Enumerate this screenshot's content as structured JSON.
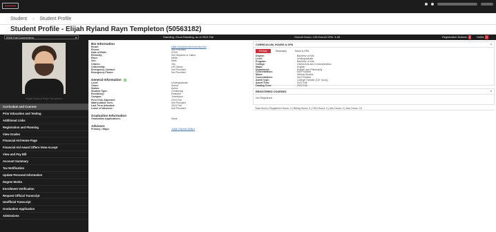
{
  "topbar": {
    "logo_icon": "university-logo-icon",
    "icons": [
      "grid-icon",
      "user-icon"
    ]
  },
  "breadcrumb": {
    "home": "Student",
    "sep": "›",
    "current": "Student Profile"
  },
  "page": {
    "title": "Student Profile - Elijah Ryland Rayn Templeton (50563182)"
  },
  "termbar": {
    "term_select": "2026 Fall Current term",
    "standing": "Standing: Good Standing, as of 2024 Fall",
    "overall_hours": "Overall Hours: 126",
    "overall_gpa": "Overall GPA: 3.48",
    "registration_notices": "Registration Notices:",
    "registration_count": "0",
    "holds": "Holds:",
    "holds_count": "0"
  },
  "sidebar": {
    "photo_caption": "Elijah Ryland Rayn Templeton",
    "items": [
      "Curriculum and Courses",
      "Prior Education and Testing",
      "Additional Links",
      "Registration and Planning",
      "View Grades",
      "Financial Aid Home Page",
      "Financial Aid Award Offers-View-Accept",
      "View and Pay Bill",
      "Account Summary",
      "Tax Notification",
      "Update Personal Information",
      "Degree Works",
      "Enrollment Verification",
      "Request Official Transcript",
      "Unofficial Transcript",
      "Graduation Application",
      "Admissions"
    ]
  },
  "bio": {
    "title": "Bio Information",
    "rows": [
      {
        "k": "Email:",
        "v": "elijah.templeton@university.edu",
        "link": true
      },
      {
        "k": "Phone:",
        "v": "Not Provided"
      },
      {
        "k": "Date of Birth:",
        "v": "07/09"
      },
      {
        "k": "Ethnicity:",
        "v": "Not Hispanic or Latino"
      },
      {
        "k": "Race:",
        "v": "White"
      },
      {
        "k": "Sex:",
        "v": "Male"
      },
      {
        "k": "Citizen:",
        "v": "Yes"
      },
      {
        "k": "Citizenship:",
        "v": "US Citizen"
      },
      {
        "k": "Emergency Contact:",
        "v": "Not Provided"
      },
      {
        "k": "Emergency Phone:",
        "v": "Not Provided"
      }
    ]
  },
  "general": {
    "title": "General Information",
    "rows": [
      {
        "k": "Level:",
        "v": "Undergraduate"
      },
      {
        "k": "Class:",
        "v": "Senior"
      },
      {
        "k": "Status:",
        "v": "Active"
      },
      {
        "k": "Student Type:",
        "v": "Continuing"
      },
      {
        "k": "Residency:",
        "v": "Resident"
      },
      {
        "k": "Campus:",
        "v": "Jonesboro"
      },
      {
        "k": "First Term Attended:",
        "v": "2019 Fall"
      },
      {
        "k": "Matriculated Term:",
        "v": "Not Provided"
      },
      {
        "k": "Last Term Attended:",
        "v": "2024 Fall"
      },
      {
        "k": "Leave of Absence:",
        "v": "Not Provided"
      }
    ]
  },
  "graduation": {
    "title": "Graduation Information",
    "rows": [
      {
        "k": "Graduation Applications:",
        "v": "None"
      }
    ]
  },
  "advisors": {
    "title": "Advisors",
    "rows": [
      {
        "k": "Primary / Major",
        "v": "Justin Randall Dillard",
        "link": true
      }
    ]
  },
  "curriculum": {
    "title": "CURRICULUM, HOURS & GPA",
    "tabs": [
      "Primary",
      "Secondary",
      "Hours & GPA"
    ],
    "rows": [
      {
        "k": "Degree:",
        "v": "Bachelor of Arts"
      },
      {
        "k": "Level:",
        "v": "Undergraduate"
      },
      {
        "k": "Program:",
        "v": "Bachelor of Arts"
      },
      {
        "k": "College:",
        "v": "Liberal Arts and Communication"
      },
      {
        "k": "Major:",
        "v": "English"
      },
      {
        "k": "Department:",
        "v": "English and Philosophy"
      },
      {
        "k": "Concentration:",
        "v": "Not Provided"
      },
      {
        "k": "Minor:",
        "v": "Writing Studies"
      },
      {
        "k": "Concentration:",
        "v": "Not Provided"
      },
      {
        "k": "Admit Type:",
        "v": "College Transfer (13+ hours)"
      },
      {
        "k": "Admit Term:",
        "v": "2022 Fall"
      },
      {
        "k": "Catalog Term:",
        "v": "2022 Fall"
      }
    ]
  },
  "registered": {
    "title": "REGISTERED COURSES",
    "body": "Not Registered",
    "totals": "Total Hours | Registered Hours: 0 | Billing Hours: 0 | CEU Hours: 0 | Min Hours: 0 | Max Hours: 19"
  }
}
